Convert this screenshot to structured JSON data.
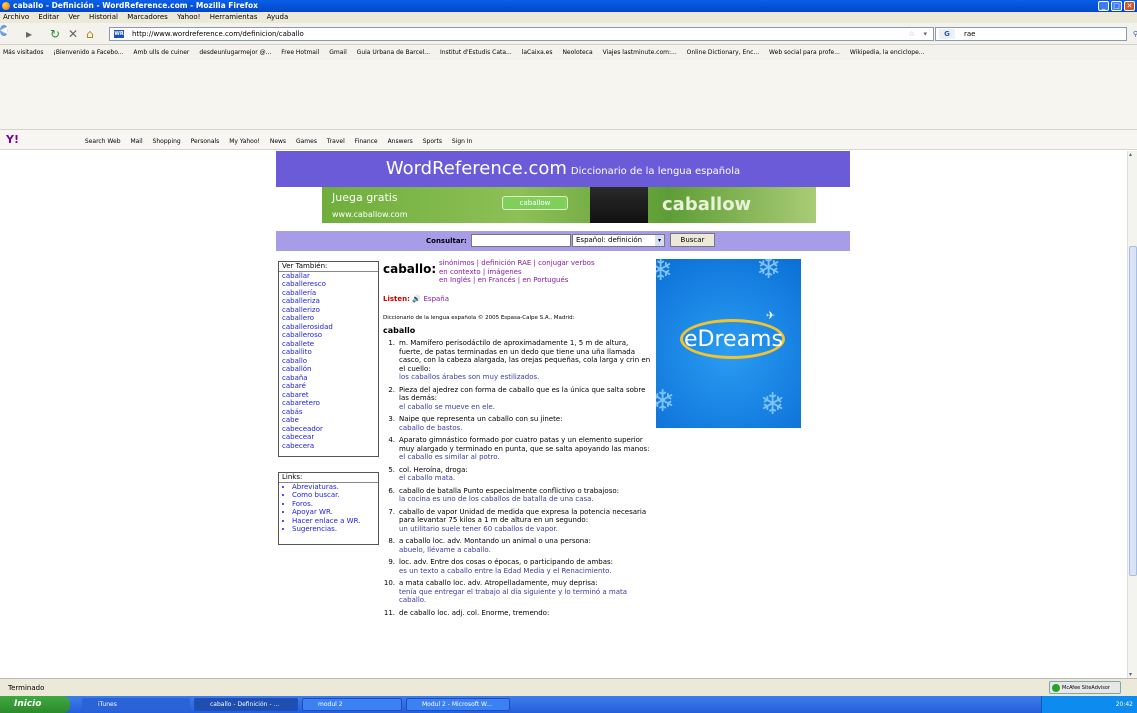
{
  "window": {
    "title": "caballo - Definición - WordReference.com - Mozilla Firefox"
  },
  "menu": [
    "Archivo",
    "Editar",
    "Ver",
    "Historial",
    "Marcadores",
    "Yahoo!",
    "Herramientas",
    "Ayuda"
  ],
  "nav": {
    "url": "http://www.wordreference.com/definicion/caballo",
    "search": "rae",
    "search_engine": "G"
  },
  "bookmarks": [
    "Más visitados",
    "¡Bienvenido a Facebo...",
    "Amb ulls de cuiner",
    "desdeunlugarmejor @...",
    "Free Hotmail",
    "Gmail",
    "Guia Urbana de Barcel...",
    "Institut d'Estudis Cata...",
    "laCaixa.es",
    "Neoloteca",
    "Viajes lastminute.com:...",
    "Online Dictionary, Enc...",
    "Web social para profe...",
    "Wikipedia, la enciclope..."
  ],
  "yahoo_toolbar": {
    "logo": "Y!",
    "items": [
      "Search Web",
      "Mail",
      "Shopping",
      "Personals",
      "My Yahoo!",
      "News",
      "Games",
      "Travel",
      "Finance",
      "Answers",
      "Sports",
      "Sign In"
    ]
  },
  "page": {
    "site": "WordReference.com",
    "site_sub": "Diccionario de la lengua española",
    "ad": {
      "headline": "Juega gratis",
      "button": "caballow",
      "url": "www.caballow.com",
      "brand": "caballow"
    },
    "consult": {
      "label": "Consultar:",
      "select": "Español: definición",
      "button": "Buscar"
    },
    "see_also": {
      "title": "Ver También:",
      "items": [
        "caballar",
        "caballeresco",
        "caballería",
        "caballeriza",
        "caballerizo",
        "caballero",
        "caballerosidad",
        "caballeroso",
        "caballete",
        "caballito",
        "caballo",
        "caballón",
        "cabaña",
        "cabaré",
        "cabaret",
        "cabaretero",
        "cabás",
        "cabe",
        "cabeceador",
        "cabecear",
        "cabecera"
      ]
    },
    "links": {
      "title": "Links:",
      "items": [
        "Abreviaturas.",
        "Como buscar.",
        "Foros.",
        "Apoyar WR.",
        "Hacer enlace a WR.",
        "Sugerencias."
      ]
    },
    "headword": "caballo:",
    "toplinks": [
      "sinónimos | definición RAE | conjugar verbos",
      "en contexto | imágenes",
      "en Inglés | en Francés | en Portugués"
    ],
    "listen": "Listen:",
    "listen_region": "España",
    "source": "Diccionario de la lengua española © 2005 Espasa-Calpe S.A., Madrid:",
    "entry": "caballo",
    "definitions": [
      {
        "n": "1.",
        "text": "m. Mamífero perisodáctilo de aproximadamente 1, 5 m de altura, fuerte, de patas terminadas en un dedo que tiene una uña llamada casco, con la cabeza alargada, las orejas pequeñas, cola larga y crin en el cuello:",
        "ex": "los caballos árabes son muy estilizados."
      },
      {
        "n": "2.",
        "text": "Pieza del ajedrez con forma de caballo que es la única que salta sobre las demás:",
        "ex": "el caballo se mueve en ele."
      },
      {
        "n": "3.",
        "text": "Naipe que representa un caballo con su jinete:",
        "ex": "caballo de bastos."
      },
      {
        "n": "4.",
        "text": "Aparato gimnástico formado por cuatro patas y un elemento superior muy alargado y terminado en punta, que se salta apoyando las manos:",
        "ex": "el caballo es similar al potro."
      },
      {
        "n": "5.",
        "text": "col. Heroína, droga:",
        "ex": "el caballo mata."
      },
      {
        "n": "6.",
        "text": "caballo de batalla Punto especialmente conflictivo o trabajoso:",
        "ex": "la cocina es uno de los caballos de batalla de una casa."
      },
      {
        "n": "7.",
        "text": "caballo de vapor Unidad de medida que expresa la potencia necesaria para levantar 75 kilos a 1 m de altura en un segundo:",
        "ex": "un utilitario suele tener 60 caballos de vapor."
      },
      {
        "n": "8.",
        "text": "a caballo loc. adv. Montando un animal o una persona:",
        "ex": "abuelo, llévame a caballo."
      },
      {
        "n": "9.",
        "text": "loc. adv. Entre dos cosas o épocas, o participando de ambas:",
        "ex": "es un texto a caballo entre la Edad Media y el Renacimiento."
      },
      {
        "n": "10.",
        "text": "a mata caballo loc. adv. Atropelladamente, muy deprisa:",
        "ex": "tenía que entregar el trabajo al día siguiente y lo terminó a mata caballo."
      },
      {
        "n": "11.",
        "text": "de caballo loc. adj. col. Enorme, tremendo:",
        "ex": ""
      }
    ],
    "edreams": "eDreams"
  },
  "status": {
    "text": "Terminado",
    "mcafee": "McAfee SiteAdvisor"
  },
  "taskbar": {
    "start": "Inicio",
    "tasks": [
      "iTunes",
      "caballo - Definición - ...",
      "modul 2",
      "Modul 2 - Microsoft W..."
    ],
    "clock": "20:42"
  }
}
